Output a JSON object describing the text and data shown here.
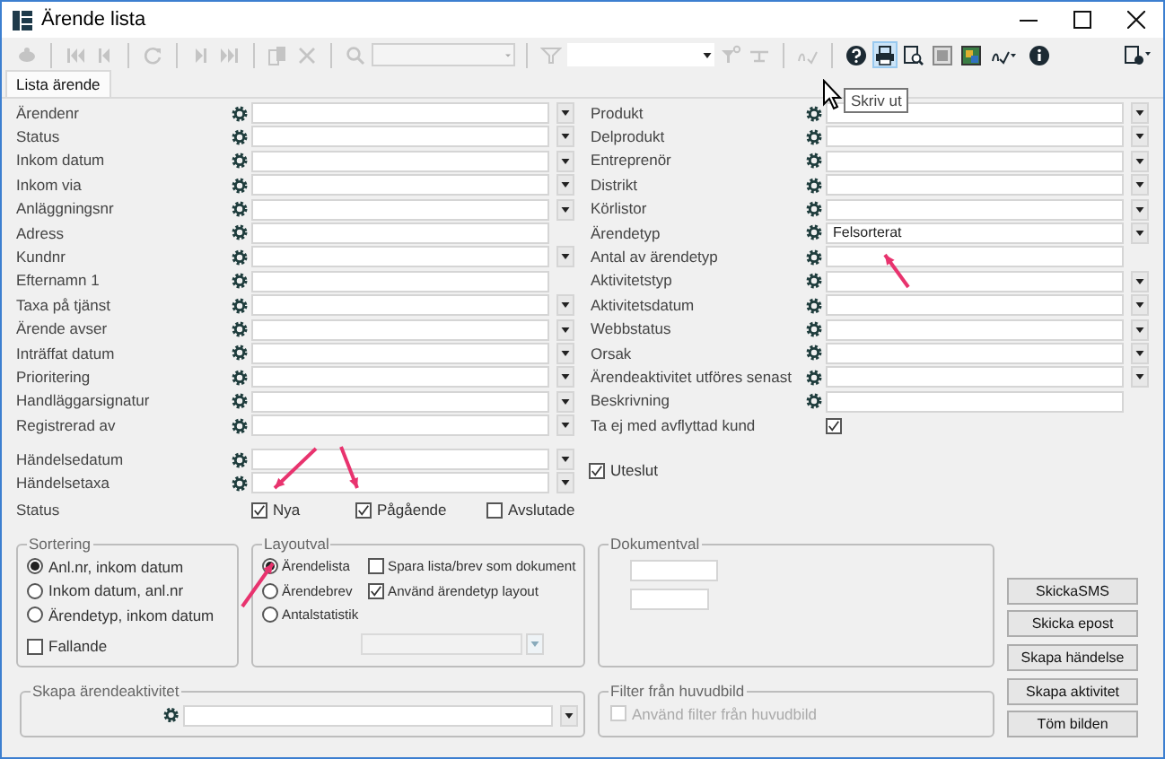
{
  "window": {
    "title": "Ärende lista"
  },
  "toolbar": [
    {
      "kind": "button",
      "disabled": true
    },
    {
      "kind": "separator"
    },
    {
      "kind": "button",
      "disabled": true
    },
    {
      "kind": "button",
      "disabled": true
    },
    {
      "kind": "separator"
    },
    {
      "kind": "button",
      "disabled": true
    },
    {
      "kind": "separator"
    },
    {
      "kind": "button",
      "disabled": true
    },
    {
      "kind": "button",
      "disabled": true
    },
    {
      "kind": "separator"
    },
    {
      "kind": "button",
      "disabled": true
    },
    {
      "kind": "button",
      "disabled": true
    },
    {
      "kind": "separator"
    },
    {
      "kind": "button",
      "disabled": true
    },
    {
      "kind": "combo",
      "disabled": true
    },
    {
      "kind": "separator"
    },
    {
      "kind": "button",
      "disabled": true
    },
    {
      "kind": "combo",
      "disabled": false
    },
    {
      "kind": "button",
      "disabled": true
    },
    {
      "kind": "button",
      "disabled": true
    },
    {
      "kind": "separator"
    },
    {
      "kind": "button",
      "disabled": true
    },
    {
      "kind": "separator"
    },
    {
      "kind": "button",
      "disabled": false
    },
    {
      "kind": "button",
      "disabled": false,
      "hovered": true
    },
    {
      "kind": "button",
      "disabled": false
    },
    {
      "kind": "button",
      "disabled": false
    },
    {
      "kind": "button",
      "disabled": false
    },
    {
      "kind": "button",
      "disabled": false
    },
    {
      "kind": "button",
      "disabled": false
    },
    {
      "kind": "spacer"
    },
    {
      "kind": "button",
      "disabled": false
    }
  ],
  "tooltip": {
    "text": "Skriv ut"
  },
  "tabs": [
    {
      "label": "Lista ärende",
      "selected": true
    }
  ],
  "left_fields": [
    {
      "label": "Ärendenr",
      "kind": "combo"
    },
    {
      "label": "Status",
      "kind": "combo"
    },
    {
      "label": "Inkom datum",
      "kind": "combo"
    },
    {
      "label": "Inkom via",
      "kind": "combo"
    },
    {
      "label": "Anläggningsnr",
      "kind": "combo"
    },
    {
      "label": "Adress",
      "kind": "text"
    },
    {
      "label": "Kundnr",
      "kind": "combo"
    },
    {
      "label": "Efternamn 1",
      "kind": "text"
    },
    {
      "label": "Taxa på tjänst",
      "kind": "combo"
    },
    {
      "label": "Ärende avser",
      "kind": "combo"
    },
    {
      "label": "Inträffat datum",
      "kind": "combo"
    },
    {
      "label": "Prioritering",
      "kind": "combo"
    },
    {
      "label": "Handläggarsignatur",
      "kind": "combo"
    },
    {
      "label": "Registrerad av",
      "kind": "combo"
    }
  ],
  "event_fields": [
    {
      "label": "Händelsedatum",
      "kind": "combo"
    },
    {
      "label": "Händelsetaxa",
      "kind": "combo"
    }
  ],
  "status": {
    "label": "Status",
    "options": [
      {
        "label": "Nya",
        "checked": true
      },
      {
        "label": "Pågående",
        "checked": true
      },
      {
        "label": "Avslutade",
        "checked": false
      }
    ]
  },
  "right_fields": [
    {
      "label": "Produkt",
      "kind": "combo"
    },
    {
      "label": "Delprodukt",
      "kind": "combo"
    },
    {
      "label": "Entreprenör",
      "kind": "combo"
    },
    {
      "label": "Distrikt",
      "kind": "combo"
    },
    {
      "label": "Körlistor",
      "kind": "combo"
    },
    {
      "label": "Ärendetyp",
      "kind": "combo",
      "value": "Felsorterat"
    },
    {
      "label": "Antal av ärendetyp",
      "kind": "text"
    },
    {
      "label": "Aktivitetstyp",
      "kind": "combo"
    },
    {
      "label": "Aktivitetsdatum",
      "kind": "combo"
    },
    {
      "label": "Webbstatus",
      "kind": "combo"
    },
    {
      "label": "Orsak",
      "kind": "combo"
    },
    {
      "label": "Ärendeaktivitet utföres senast",
      "kind": "combo"
    },
    {
      "label": "Beskrivning",
      "kind": "text"
    },
    {
      "label": "Ta ej med avflyttad kund",
      "kind": "checkbox",
      "checked": true
    }
  ],
  "exclude": {
    "label": "Uteslut",
    "checked": true
  },
  "sorting": {
    "title": "Sortering",
    "options": [
      {
        "label": "Anl.nr, inkom datum",
        "selected": true
      },
      {
        "label": "Inkom datum, anl.nr",
        "selected": false
      },
      {
        "label": "Ärendetyp, inkom datum",
        "selected": false
      }
    ],
    "descending": {
      "label": "Fallande",
      "checked": false
    }
  },
  "layout": {
    "title": "Layoutval",
    "options": [
      {
        "label": "Ärendelista",
        "selected": true
      },
      {
        "label": "Ärendebrev",
        "selected": false
      },
      {
        "label": "Antalstatistik",
        "selected": false
      }
    ],
    "checks": [
      {
        "label": "Spara lista/brev som dokument",
        "checked": false
      },
      {
        "label": "Använd ärendetyp layout",
        "checked": true
      }
    ],
    "combo": {
      "disabled": true
    }
  },
  "documents": {
    "title": "Dokumentval",
    "fields": [
      {
        "kind": "text"
      },
      {
        "kind": "short_text"
      }
    ]
  },
  "create_activity": {
    "title": "Skapa ärendeaktivitet"
  },
  "filter": {
    "title": "Filter från huvudbild",
    "checkbox": {
      "label": "Använd filter från huvudbild",
      "checked": false,
      "disabled": true
    }
  },
  "buttons": [
    "SkickaSMS",
    "Skicka epost",
    "Skapa händelse",
    "Skapa aktivitet",
    "Töm bilden"
  ]
}
